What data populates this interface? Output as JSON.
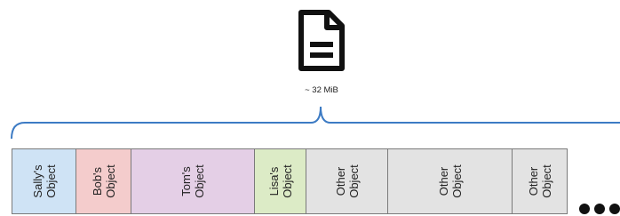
{
  "file": {
    "icon": "document-icon",
    "size_label": "~ 32 MiB"
  },
  "objects": [
    {
      "label": "Sally's\nObject",
      "color": "#cfe3f5"
    },
    {
      "label": "Bob's\nObject",
      "color": "#f4cccc"
    },
    {
      "label": "Tom's\nObject",
      "color": "#e4cfe6"
    },
    {
      "label": "Lisa's\nObject",
      "color": "#dcebc6"
    },
    {
      "label": "Other\nObject",
      "color": "#e3e3e3"
    },
    {
      "label": "Other\nObject",
      "color": "#e3e3e3"
    },
    {
      "label": "Other\nObject",
      "color": "#e3e3e3"
    }
  ],
  "continuation_icon": "ellipsis-icon"
}
